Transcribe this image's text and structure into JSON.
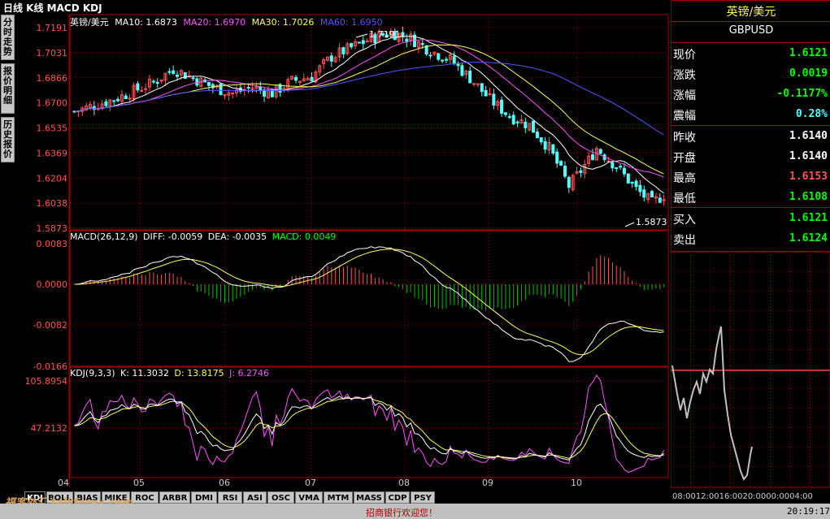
{
  "window": {
    "title": "日线 K线 MACD KDJ"
  },
  "side_tabs": [
    {
      "label": "分时走势"
    },
    {
      "label": "报价明细"
    },
    {
      "label": "历史报价"
    }
  ],
  "price_panel": {
    "legend_name": "英镑/美元",
    "ma10": "MA10: 1.6873",
    "ma20": "MA20: 1.6970",
    "ma30": "MA30: 1.7026",
    "ma60": "MA60: 1.6950",
    "high_annotation": "1.7191",
    "low_annotation": "1.5873",
    "y_ticks": [
      "1.7191",
      "1.7031",
      "1.6866",
      "1.6700",
      "1.6535",
      "1.6369",
      "1.6204",
      "1.6038",
      "1.5873"
    ]
  },
  "macd_panel": {
    "title": "MACD(26,12,9)",
    "diff": "DIFF: -0.0059",
    "dea": "DEA: -0.0035",
    "macd": "MACD: 0.0049",
    "y_ticks": [
      "0.0083",
      "0.0000",
      "-0.0082",
      "-0.0166"
    ]
  },
  "kdj_panel": {
    "title": "KDJ(9,3,3)",
    "k": "K: 11.3032",
    "d": "D: 13.8175",
    "j": "J: 6.2746",
    "y_ticks": [
      "105.8954",
      "47.2132"
    ]
  },
  "x_axis": {
    "labels": [
      "04",
      "05",
      "06",
      "07",
      "08",
      "09",
      "10"
    ]
  },
  "quote": {
    "name": "英镑/美元",
    "code": "GBPUSD",
    "rows": [
      {
        "label": "现价",
        "value": "1.6121",
        "color": "#00ff00"
      },
      {
        "label": "涨跌",
        "value": "0.0019",
        "color": "#00ff00"
      },
      {
        "label": "涨幅",
        "value": "-0.1177%",
        "color": "#00ff00"
      },
      {
        "label": "震幅",
        "value": "0.28%",
        "color": "#54ffff"
      },
      {
        "label": "昨收",
        "value": "1.6140",
        "color": "#ffffff"
      },
      {
        "label": "开盘",
        "value": "1.6140",
        "color": "#ffffff"
      },
      {
        "label": "最高",
        "value": "1.6153",
        "color": "#ff5454"
      },
      {
        "label": "最低",
        "value": "1.6108",
        "color": "#00ff00"
      },
      {
        "label": "买入",
        "value": "1.6121",
        "color": "#00ff00"
      },
      {
        "label": "卖出",
        "value": "1.6124",
        "color": "#00ff00"
      }
    ],
    "intraday_x_labels": "08:0012:0016:0020:0000:0004:00"
  },
  "bottom_tabs": [
    "KDJ",
    "BOLL",
    "BIAS",
    "MIKE",
    "ROC",
    "ARBR",
    "DMI",
    "RSI",
    "ASI",
    "OSC",
    "VMA",
    "MTM",
    "MASS",
    "CDP",
    "PSY"
  ],
  "status": {
    "message": "招商银行欢迎您！",
    "time": "20:19:17"
  },
  "watermark": "福客外汇 talkforex.com",
  "colors": {
    "up": "#ff5454",
    "down": "#54ffff",
    "ma10": "#ffffff",
    "ma20": "#ff54ff",
    "ma30": "#ffff54",
    "ma60": "#5454ff",
    "grid": "#a00000",
    "macd_neg": "#00c000"
  }
}
